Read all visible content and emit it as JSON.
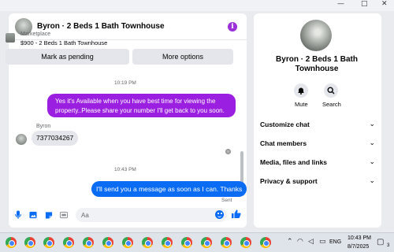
{
  "window": {
    "minimize": "—",
    "maximize": "□",
    "close": "✕"
  },
  "chat": {
    "title": "Byron · 2 Beds 1 Bath Townhouse",
    "info_icon": "i",
    "marketplace_label": "Marketplace",
    "listing": "$900 - 2 Beds 1 Bath Townhouse",
    "buttons": {
      "mark_pending": "Mark as pending",
      "more_options": "More options"
    },
    "messages": [
      {
        "timestamp": "10:19 PM"
      },
      {
        "direction": "out",
        "text": "Yes it's Available when you have best time for viewing the property..Please share your number I'll get back to you soon."
      },
      {
        "direction": "in",
        "sender": "Byron",
        "text": "7377034267"
      },
      {
        "timestamp": "10:43 PM"
      },
      {
        "direction": "out",
        "text": "I'll send you a message as soon as I can. Thanks",
        "status": "Sent"
      }
    ],
    "composer": {
      "placeholder": "Aa",
      "icons": [
        "microphone-icon",
        "image-icon",
        "sticker-icon",
        "gif-icon",
        "emoji-icon",
        "like-icon"
      ]
    },
    "colors": {
      "purple_bubble": "#9b1fe0",
      "blue_bubble": "#0a6cf5",
      "accent": "#0a6cf5"
    }
  },
  "info_panel": {
    "title": "Byron · 2 Beds 1 Bath Townhouse",
    "actions": [
      {
        "label": "Mute",
        "icon": "bell-icon"
      },
      {
        "label": "Search",
        "icon": "search-icon"
      }
    ],
    "sections": [
      {
        "label": "Customize chat"
      },
      {
        "label": "Chat members"
      },
      {
        "label": "Media, files and links"
      },
      {
        "label": "Privacy & support"
      }
    ]
  },
  "taskbar": {
    "language": "ENG",
    "time": "10:43 PM",
    "date": "8/7/2025",
    "notification_count": "3"
  }
}
